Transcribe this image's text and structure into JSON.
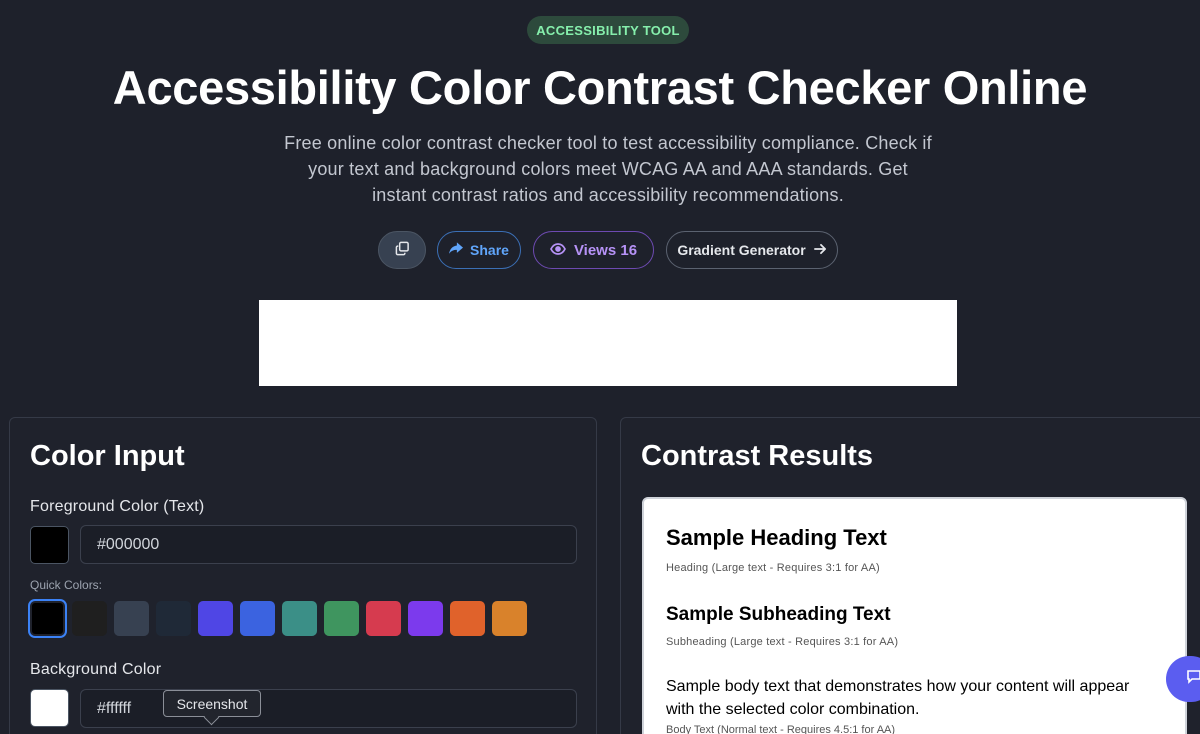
{
  "badge": "ACCESSIBILITY TOOL",
  "title": "Accessibility Color Contrast Checker Online",
  "subtitle": "Free online color contrast checker tool to test accessibility compliance. Check if your text and background colors meet WCAG AA and AAA standards. Get instant contrast ratios and accessibility recommendations.",
  "actions": {
    "copy_icon": "copy-icon",
    "share_label": "Share",
    "views_label": "Views 16",
    "gradient_label": "Gradient Generator"
  },
  "color_input": {
    "title": "Color Input",
    "foreground_label": "Foreground Color (Text)",
    "foreground_value": "#000000",
    "foreground_color": "#000000",
    "quick_colors_label": "Quick Colors:",
    "quick_colors": [
      "#000000",
      "#1f1f1f",
      "#374151",
      "#1f2937",
      "#4f46e5",
      "#3b63e0",
      "#3b8f87",
      "#3f955f",
      "#d63b4f",
      "#7c3aed",
      "#e0622b",
      "#d9822b"
    ],
    "background_label": "Background Color",
    "background_value": "#ffffff",
    "background_color": "#ffffff"
  },
  "tooltip": "Screenshot",
  "results": {
    "title": "Contrast Results",
    "heading": "Sample Heading Text",
    "heading_note": "Heading (Large text - Requires 3:1 for AA)",
    "subheading": "Sample Subheading Text",
    "subheading_note": "Subheading (Large text - Requires 3:1 for AA)",
    "body": "Sample body text that demonstrates how your content will appear with the selected color combination.",
    "body_note": "Body Text (Normal text - Requires 4.5:1 for AA)"
  },
  "chat_icon": "chat-icon"
}
